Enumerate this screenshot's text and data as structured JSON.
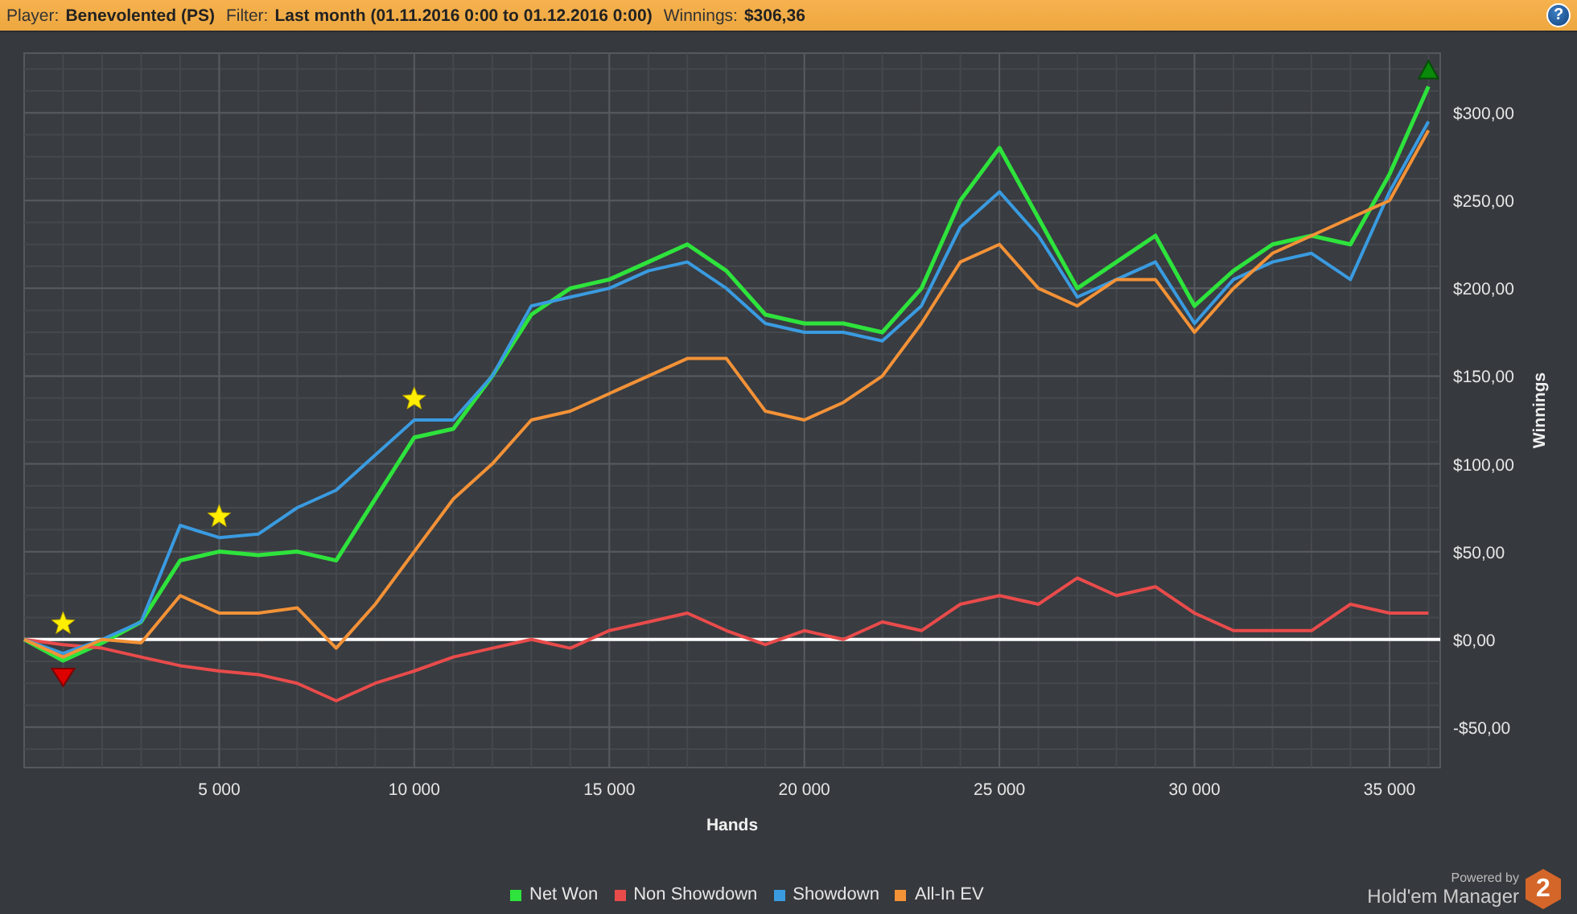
{
  "header": {
    "fields": [
      {
        "label": "Player:",
        "value": "Benevolented (PS)"
      },
      {
        "label": "Filter:",
        "value": "Last month (01.11.2016 0:00 to 01.12.2016 0:00)"
      },
      {
        "label": "Winnings:",
        "value": "$306,36"
      }
    ],
    "help": "?"
  },
  "chart": {
    "chart_data": {
      "type": "line",
      "xlabel": "Hands",
      "ylabel": "Winnings",
      "x": [
        0,
        1000,
        2000,
        3000,
        4000,
        5000,
        6000,
        7000,
        8000,
        9000,
        10000,
        11000,
        12000,
        13000,
        14000,
        15000,
        16000,
        17000,
        18000,
        19000,
        20000,
        21000,
        22000,
        23000,
        24000,
        25000,
        26000,
        27000,
        28000,
        29000,
        30000,
        31000,
        32000,
        33000,
        34000,
        35000,
        36000
      ],
      "series": [
        {
          "name": "Net Won",
          "color": "#2ee33c",
          "values": [
            0,
            -12,
            -2,
            10,
            45,
            50,
            48,
            50,
            45,
            80,
            115,
            120,
            150,
            185,
            200,
            205,
            215,
            225,
            210,
            185,
            180,
            180,
            175,
            200,
            250,
            280,
            240,
            200,
            215,
            230,
            190,
            210,
            225,
            230,
            225,
            265,
            315
          ]
        },
        {
          "name": "Non Showdown",
          "color": "#e94b4b",
          "values": [
            0,
            -3,
            -5,
            -10,
            -15,
            -18,
            -20,
            -25,
            -35,
            -25,
            -18,
            -10,
            -5,
            0,
            -5,
            5,
            10,
            15,
            5,
            -3,
            5,
            0,
            10,
            5,
            20,
            25,
            20,
            35,
            25,
            30,
            15,
            5,
            5,
            5,
            20,
            15,
            15
          ]
        },
        {
          "name": "Showdown",
          "color": "#3a9be0",
          "values": [
            0,
            -8,
            0,
            10,
            65,
            58,
            60,
            75,
            85,
            105,
            125,
            125,
            150,
            190,
            195,
            200,
            210,
            215,
            200,
            180,
            175,
            175,
            170,
            190,
            235,
            255,
            230,
            195,
            205,
            215,
            180,
            205,
            215,
            220,
            205,
            255,
            295
          ]
        },
        {
          "name": "All-In EV",
          "color": "#f39237",
          "values": [
            0,
            -10,
            0,
            -2,
            25,
            15,
            15,
            18,
            -5,
            20,
            50,
            80,
            100,
            125,
            130,
            140,
            150,
            160,
            160,
            130,
            125,
            135,
            150,
            180,
            215,
            225,
            200,
            190,
            205,
            205,
            175,
            200,
            220,
            230,
            240,
            250,
            290
          ]
        }
      ],
      "xlim": [
        0,
        36300
      ],
      "ylim": [
        -73,
        334
      ],
      "xticks": [
        {
          "value": 5000,
          "label": "5 000"
        },
        {
          "value": 10000,
          "label": "10 000"
        },
        {
          "value": 15000,
          "label": "15 000"
        },
        {
          "value": 20000,
          "label": "20 000"
        },
        {
          "value": 25000,
          "label": "25 000"
        },
        {
          "value": 30000,
          "label": "30 000"
        },
        {
          "value": 35000,
          "label": "35 000"
        }
      ],
      "yticks": [
        {
          "value": -50,
          "label": "-$50,00"
        },
        {
          "value": 0,
          "label": "$0,00"
        },
        {
          "value": 50,
          "label": "$50,00"
        },
        {
          "value": 100,
          "label": "$100,00"
        },
        {
          "value": 150,
          "label": "$150,00"
        },
        {
          "value": 200,
          "label": "$200,00"
        },
        {
          "value": 250,
          "label": "$250,00"
        },
        {
          "value": 300,
          "label": "$300,00"
        }
      ],
      "grid": true
    }
  },
  "footer": {
    "powered_by": "Powered by",
    "brand": "Hold'em Manager",
    "badge": "2"
  }
}
